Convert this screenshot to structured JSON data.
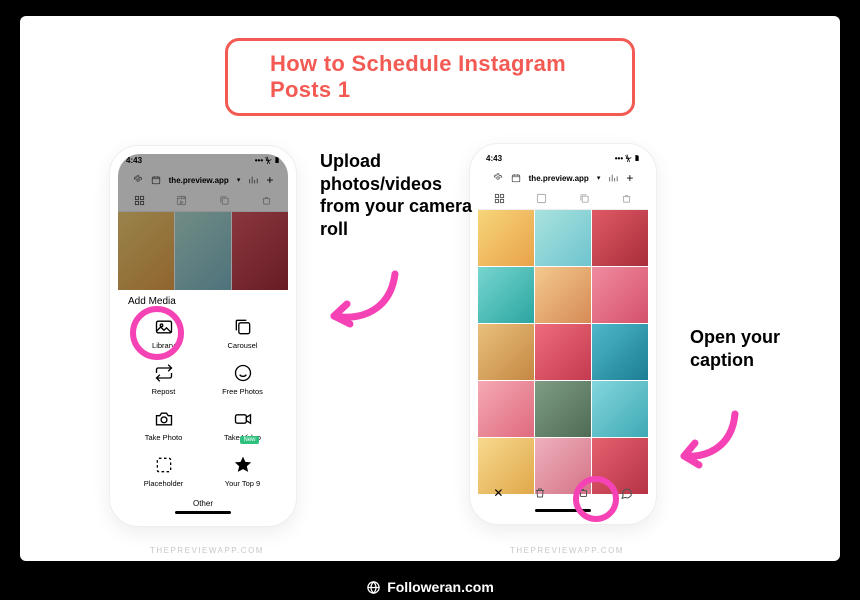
{
  "title": "How to Schedule Instagram Posts 1",
  "callouts": {
    "upload": "Upload photos/videos from your camera roll",
    "caption": "Open your caption"
  },
  "phoneLeft": {
    "time": "4:43",
    "account": "the.preview.app",
    "sheetTitle": "Add Media",
    "media": {
      "library": "Library",
      "carousel": "Carousel",
      "repost": "Repost",
      "freePhotos": "Free Photos",
      "takePhoto": "Take Photo",
      "takeVideo": "Take Video",
      "placeholder": "Placeholder",
      "yourTop9": "Your Top 9"
    },
    "other": "Other"
  },
  "phoneRight": {
    "time": "4:43",
    "account": "the.preview.app"
  },
  "source": "THEPREVIEWAPP.COM",
  "footer": "Followeran.com",
  "colors": {
    "accent": "#f25a53",
    "highlight": "#f542b4"
  }
}
